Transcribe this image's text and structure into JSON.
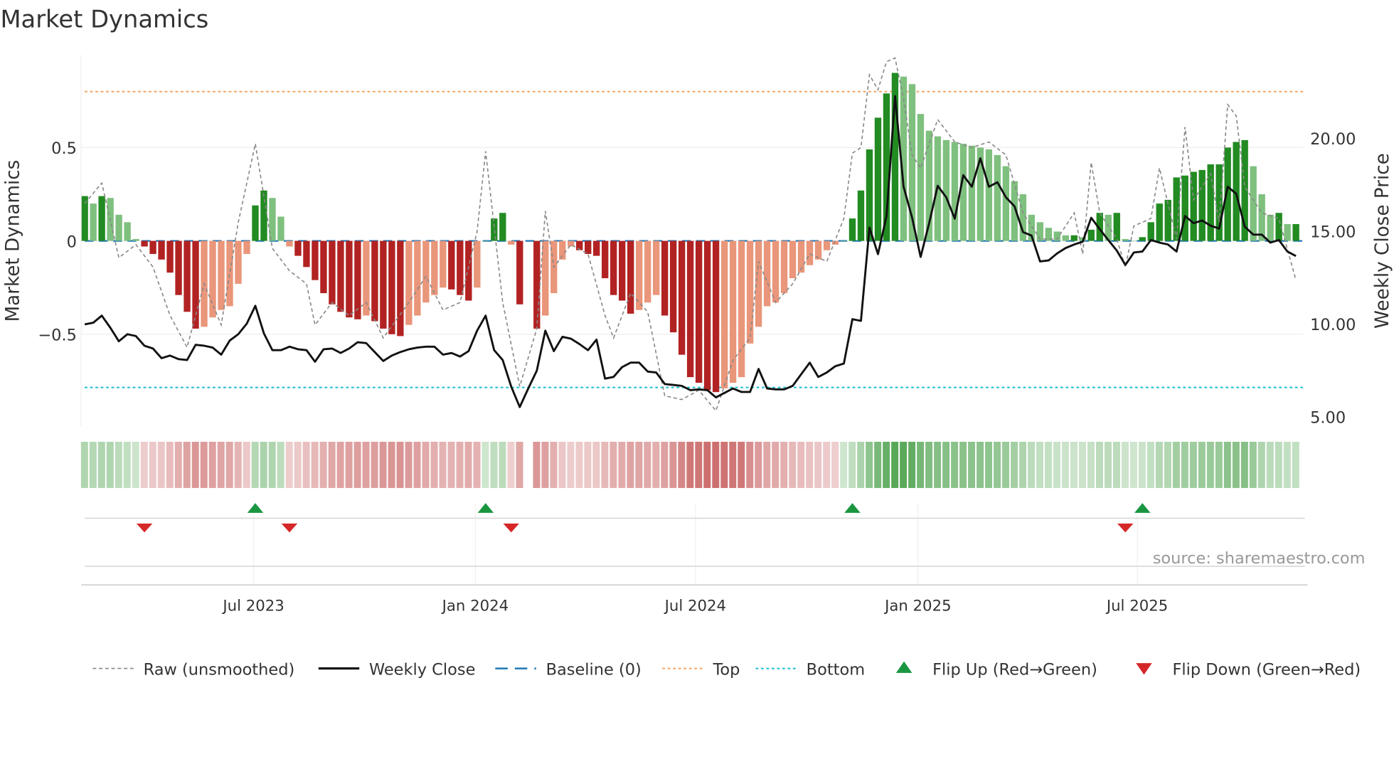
{
  "title": "Market Dynamics",
  "source": "source: sharemaestro.com",
  "colors": {
    "green_dark": "#228b22",
    "green_light": "#7fc07f",
    "red_dark": "#b22222",
    "red_light": "#e9967a",
    "raw": "#888888",
    "close": "#111111",
    "baseline": "#1f77b4",
    "top": "#f4a460",
    "bottom": "#17becf",
    "flip_up": "#1a9641",
    "flip_down": "#d62728"
  },
  "chart_data": {
    "type": "bar",
    "title": "Market Dynamics",
    "ylabel": "Market Dynamics",
    "y2label": "Weekly Close Price",
    "ylim": [
      -1.0,
      0.98
    ],
    "y2lim": [
      5.0,
      24.85
    ],
    "yticks": [
      {
        "v": 0.5,
        "label": "0.5"
      },
      {
        "v": 0,
        "label": "0"
      },
      {
        "v": -0.5,
        "label": "−0.5"
      }
    ],
    "y2ticks": [
      {
        "v": 20,
        "label": "20.00"
      },
      {
        "v": 15,
        "label": "15.00"
      },
      {
        "v": 10,
        "label": "10.00"
      },
      {
        "v": 5,
        "label": "5.00"
      }
    ],
    "xticks": [
      {
        "week": 19.8,
        "label": "Jul 2023"
      },
      {
        "week": 45.8,
        "label": "Jan 2024"
      },
      {
        "week": 71.6,
        "label": "Jul 2024"
      },
      {
        "week": 97.7,
        "label": "Jan 2025"
      },
      {
        "week": 123.4,
        "label": "Jul 2025"
      }
    ],
    "weeks": 143,
    "top_level": 0.8,
    "bottom_level": -0.785,
    "baseline": 0,
    "bars": [
      0.24,
      0.2,
      0.24,
      0.23,
      0.14,
      0.1,
      0.01,
      -0.03,
      -0.07,
      -0.1,
      -0.17,
      -0.29,
      -0.38,
      -0.47,
      -0.46,
      -0.41,
      -0.37,
      -0.35,
      -0.23,
      -0.07,
      0.19,
      0.27,
      0.23,
      0.13,
      -0.03,
      -0.08,
      -0.14,
      -0.21,
      -0.28,
      -0.34,
      -0.38,
      -0.41,
      -0.42,
      -0.4,
      -0.43,
      -0.47,
      -0.5,
      -0.51,
      -0.45,
      -0.4,
      -0.33,
      -0.29,
      -0.25,
      -0.26,
      -0.29,
      -0.32,
      -0.25,
      0.0,
      0.12,
      0.15,
      -0.02,
      -0.34,
      null,
      -0.47,
      -0.4,
      -0.28,
      -0.1,
      -0.03,
      -0.05,
      -0.07,
      -0.08,
      -0.2,
      -0.29,
      -0.32,
      -0.39,
      -0.37,
      -0.33,
      -0.29,
      -0.4,
      -0.49,
      -0.61,
      -0.73,
      -0.76,
      -0.8,
      -0.81,
      -0.79,
      -0.76,
      -0.73,
      -0.55,
      -0.46,
      -0.35,
      -0.33,
      -0.28,
      -0.2,
      -0.17,
      -0.13,
      -0.1,
      -0.05,
      -0.02,
      0.0,
      0.12,
      0.27,
      0.49,
      0.66,
      0.79,
      0.9,
      0.88,
      0.84,
      0.68,
      0.59,
      0.56,
      0.54,
      0.53,
      0.52,
      0.51,
      0.5,
      0.49,
      0.46,
      0.4,
      0.32,
      0.25,
      0.14,
      0.1,
      0.07,
      0.05,
      0.03,
      0.03,
      0.02,
      0.06,
      0.15,
      0.14,
      0.15,
      0.01,
      0.0,
      0.02,
      0.1,
      0.2,
      0.22,
      0.34,
      0.35,
      0.37,
      0.38,
      0.41,
      0.41,
      0.5,
      0.53,
      0.54,
      0.4,
      0.25,
      0.14,
      0.15,
      0.09,
      0.09
    ],
    "raw": [
      [
        0,
        0.2
      ],
      [
        2,
        0.31
      ],
      [
        4,
        -0.09
      ],
      [
        6,
        -0.02
      ],
      [
        8,
        -0.14
      ],
      [
        10,
        -0.4
      ],
      [
        12,
        -0.57
      ],
      [
        14,
        -0.23
      ],
      [
        16,
        -0.45
      ],
      [
        18,
        0.1
      ],
      [
        20,
        0.52
      ],
      [
        22,
        -0.04
      ],
      [
        24,
        -0.16
      ],
      [
        26,
        -0.23
      ],
      [
        27,
        -0.45
      ],
      [
        29,
        -0.33
      ],
      [
        31,
        -0.4
      ],
      [
        33,
        -0.33
      ],
      [
        35,
        -0.52
      ],
      [
        38,
        -0.33
      ],
      [
        40,
        -0.19
      ],
      [
        42,
        -0.37
      ],
      [
        44,
        -0.33
      ],
      [
        46,
        0.05
      ],
      [
        47,
        0.48
      ],
      [
        49,
        -0.33
      ],
      [
        51,
        -0.78
      ],
      [
        53,
        -0.47
      ],
      [
        54,
        0.16
      ],
      [
        55,
        -0.14
      ],
      [
        57,
        -0.02
      ],
      [
        59,
        -0.07
      ],
      [
        61,
        -0.4
      ],
      [
        62,
        -0.52
      ],
      [
        64,
        -0.28
      ],
      [
        66,
        -0.38
      ],
      [
        68,
        -0.83
      ],
      [
        70,
        -0.85
      ],
      [
        72,
        -0.8
      ],
      [
        74,
        -0.91
      ],
      [
        76,
        -0.64
      ],
      [
        78,
        -0.52
      ],
      [
        79,
        -0.11
      ],
      [
        81,
        -0.33
      ],
      [
        83,
        -0.23
      ],
      [
        85,
        -0.07
      ],
      [
        87,
        -0.11
      ],
      [
        89,
        0.12
      ],
      [
        90,
        0.47
      ],
      [
        91,
        0.5
      ],
      [
        92,
        0.89
      ],
      [
        93,
        0.81
      ],
      [
        94,
        0.96
      ],
      [
        95,
        0.98
      ],
      [
        96,
        0.76
      ],
      [
        97,
        0.46
      ],
      [
        98,
        0.39
      ],
      [
        100,
        0.65
      ],
      [
        102,
        0.53
      ],
      [
        104,
        0.5
      ],
      [
        106,
        0.53
      ],
      [
        108,
        0.46
      ],
      [
        110,
        0.15
      ],
      [
        112,
        0.01
      ],
      [
        114,
        0.01
      ],
      [
        116,
        0.15
      ],
      [
        117,
        -0.07
      ],
      [
        118,
        0.42
      ],
      [
        119,
        0.15
      ],
      [
        121,
        0.01
      ],
      [
        122,
        -0.14
      ],
      [
        123,
        0.08
      ],
      [
        125,
        0.12
      ],
      [
        126,
        0.39
      ],
      [
        128,
        0.01
      ],
      [
        129,
        0.61
      ],
      [
        130,
        0.22
      ],
      [
        132,
        0.36
      ],
      [
        133,
        0.1
      ],
      [
        134,
        0.73
      ],
      [
        135,
        0.67
      ],
      [
        136,
        0.29
      ],
      [
        138,
        0.15
      ],
      [
        140,
        0.12
      ],
      [
        142,
        -0.21
      ]
    ],
    "close": [
      9.98,
      10.07,
      10.45,
      9.8,
      9.07,
      9.45,
      9.35,
      8.83,
      8.68,
      8.16,
      8.3,
      8.11,
      8.06,
      8.88,
      8.83,
      8.73,
      8.35,
      9.11,
      9.45,
      10.02,
      10.98,
      9.5,
      8.59,
      8.59,
      8.78,
      8.64,
      8.59,
      7.97,
      8.64,
      8.68,
      8.44,
      8.68,
      9.02,
      8.97,
      8.49,
      8.01,
      8.3,
      8.49,
      8.64,
      8.73,
      8.78,
      8.78,
      8.35,
      8.44,
      8.25,
      8.54,
      9.64,
      10.45,
      8.59,
      8.06,
      6.63,
      5.53,
      6.53,
      7.49,
      9.64,
      8.54,
      9.31,
      9.21,
      8.92,
      8.59,
      9.16,
      7.06,
      7.15,
      7.68,
      7.92,
      7.92,
      7.44,
      7.39,
      6.77,
      6.72,
      6.67,
      6.44,
      6.48,
      6.44,
      6.05,
      6.29,
      6.53,
      6.34,
      6.34,
      7.58,
      6.53,
      6.48,
      6.48,
      6.67,
      7.3,
      7.92,
      7.15,
      7.39,
      7.73,
      7.87,
      10.26,
      10.17,
      15.19,
      13.76,
      15.81,
      22.27,
      17.39,
      15.72,
      13.61,
      15.43,
      17.44,
      16.82,
      15.67,
      18.01,
      17.39,
      18.92,
      17.39,
      17.63,
      16.82,
      16.34,
      14.95,
      14.76,
      13.37,
      13.42,
      13.8,
      14.09,
      14.28,
      14.43,
      15.72,
      15.1,
      14.52,
      13.95,
      13.18,
      13.85,
      13.9,
      14.52,
      14.38,
      14.28,
      13.9,
      15.81,
      15.43,
      15.57,
      15.29,
      15.14,
      17.39,
      17.01,
      15.24,
      14.81,
      14.81,
      14.38,
      14.52,
      13.9,
      13.66
    ],
    "flip_up_weeks": [
      20,
      47,
      90,
      124
    ],
    "flip_down_weeks": [
      7,
      24,
      50,
      122
    ],
    "legend": {
      "placement": "bottom",
      "items": [
        {
          "key": "raw",
          "label": "Raw (unsmoothed)"
        },
        {
          "key": "close",
          "label": "Weekly Close"
        },
        {
          "key": "baseline",
          "label": "Baseline (0)"
        },
        {
          "key": "top",
          "label": "Top"
        },
        {
          "key": "bottom",
          "label": "Bottom"
        },
        {
          "key": "flip_up",
          "label": "Flip Up (Red→Green)"
        },
        {
          "key": "flip_down",
          "label": "Flip Down (Green→Red)"
        }
      ]
    }
  }
}
